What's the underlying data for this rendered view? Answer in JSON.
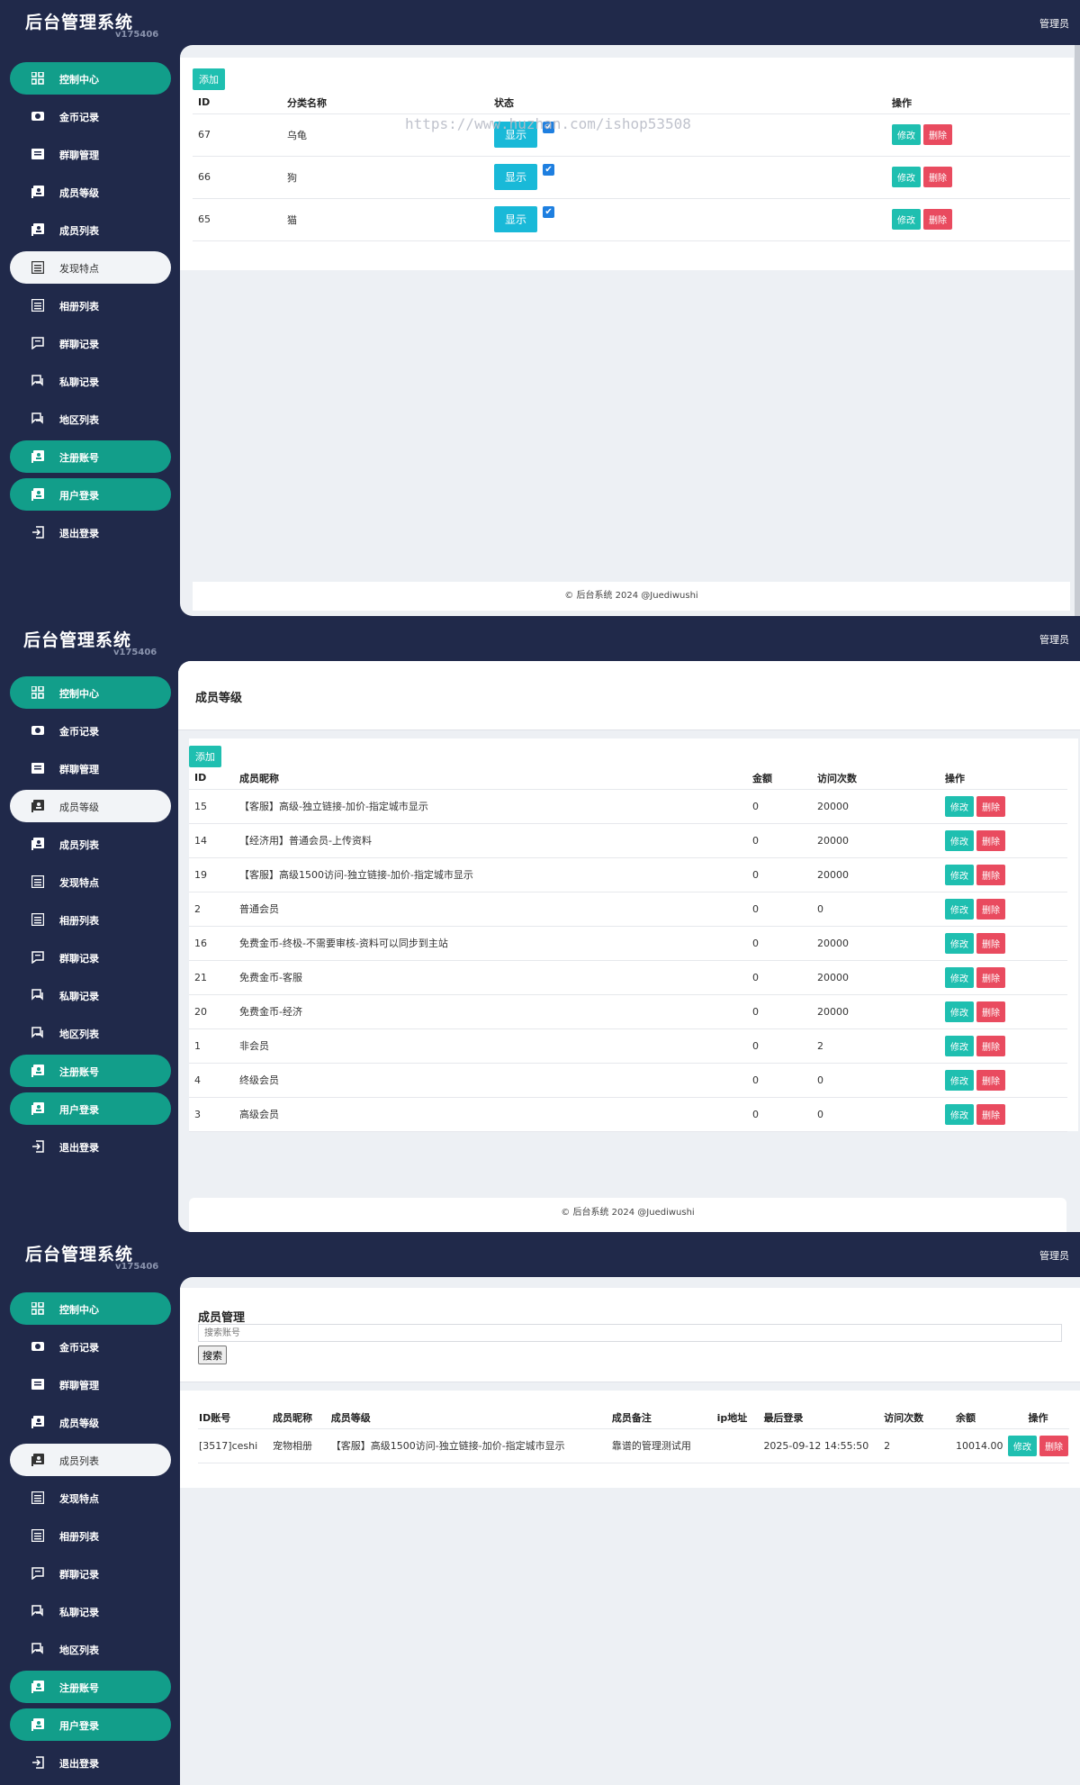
{
  "app": {
    "title": "后台管理系统",
    "version": "v175406",
    "admin": "管理员"
  },
  "nav_items": [
    {
      "label": "控制中心",
      "icon": "dashboard-icon"
    },
    {
      "label": "金币记录",
      "icon": "coin-icon"
    },
    {
      "label": "群聊管理",
      "icon": "group-icon"
    },
    {
      "label": "成员等级",
      "icon": "member-level-icon"
    },
    {
      "label": "成员列表",
      "icon": "member-list-icon"
    },
    {
      "label": "发现特点",
      "icon": "discover-icon"
    },
    {
      "label": "相册列表",
      "icon": "album-icon"
    },
    {
      "label": "群聊记录",
      "icon": "chat-icon"
    },
    {
      "label": "私聊记录",
      "icon": "private-chat-icon"
    },
    {
      "label": "地区列表",
      "icon": "region-icon"
    },
    {
      "label": "注册账号",
      "icon": "register-icon"
    },
    {
      "label": "用户登录",
      "icon": "login-icon"
    },
    {
      "label": "退出登录",
      "icon": "logout-icon"
    }
  ],
  "common": {
    "add": "添加",
    "edit": "修改",
    "delete": "删除",
    "show": "显示",
    "check": "✔",
    "footer": "© 后台系统 2024 @Juediwushi",
    "watermark": "https://www.huzhan.com/ishop53508"
  },
  "panel1": {
    "headers": {
      "id": "ID",
      "name": "分类名称",
      "status": "状态",
      "op": "操作"
    },
    "rows": [
      {
        "id": "67",
        "name": "乌龟"
      },
      {
        "id": "66",
        "name": "狗"
      },
      {
        "id": "65",
        "name": "猫"
      }
    ]
  },
  "panel2": {
    "page_title": "成员等级",
    "headers": {
      "id": "ID",
      "nick": "成员昵称",
      "amount": "金额",
      "visits": "访问次数",
      "op": "操作"
    },
    "rows": [
      {
        "id": "15",
        "nick": "【客服】高级-独立链接-加价-指定城市显示",
        "amount": "0",
        "visits": "20000"
      },
      {
        "id": "14",
        "nick": "【经济用】普通会员-上传资料",
        "amount": "0",
        "visits": "20000"
      },
      {
        "id": "19",
        "nick": "【客服】高级1500访问-独立链接-加价-指定城市显示",
        "amount": "0",
        "visits": "20000"
      },
      {
        "id": "2",
        "nick": "普通会员",
        "amount": "0",
        "visits": "0"
      },
      {
        "id": "16",
        "nick": "免费金币-终极-不需要审核-资料可以同步到主站",
        "amount": "0",
        "visits": "20000"
      },
      {
        "id": "21",
        "nick": "免费金币-客服",
        "amount": "0",
        "visits": "20000"
      },
      {
        "id": "20",
        "nick": "免费金币-经济",
        "amount": "0",
        "visits": "20000"
      },
      {
        "id": "1",
        "nick": "非会员",
        "amount": "0",
        "visits": "2"
      },
      {
        "id": "4",
        "nick": "终级会员",
        "amount": "0",
        "visits": "0"
      },
      {
        "id": "3",
        "nick": "高级会员",
        "amount": "0",
        "visits": "0"
      }
    ]
  },
  "panel3": {
    "page_title": "成员管理",
    "search_placeholder": "搜索账号",
    "search_button": "搜索",
    "headers": {
      "id": "ID账号",
      "nick": "成员昵称",
      "level": "成员等级",
      "remark": "成员备注",
      "ip": "ip地址",
      "last": "最后登录",
      "visits": "访问次数",
      "balance": "余额",
      "op": "操作"
    },
    "rows": [
      {
        "id": "[3517]ceshi",
        "nick": "宠物相册",
        "level": "【客服】高级1500访问-独立链接-加价-指定城市显示",
        "remark": "靠谱的管理测试用",
        "ip": "",
        "last": "2025-09-12 14:55:50",
        "visits": "2",
        "balance": "10014.00"
      }
    ]
  },
  "colors": {
    "sidebar": "#20294a",
    "active_green": "#129e8a",
    "active_white": "#f2f4f7",
    "edit": "#1fbfb0",
    "delete": "#e94b5f",
    "show": "#19b9d8"
  }
}
